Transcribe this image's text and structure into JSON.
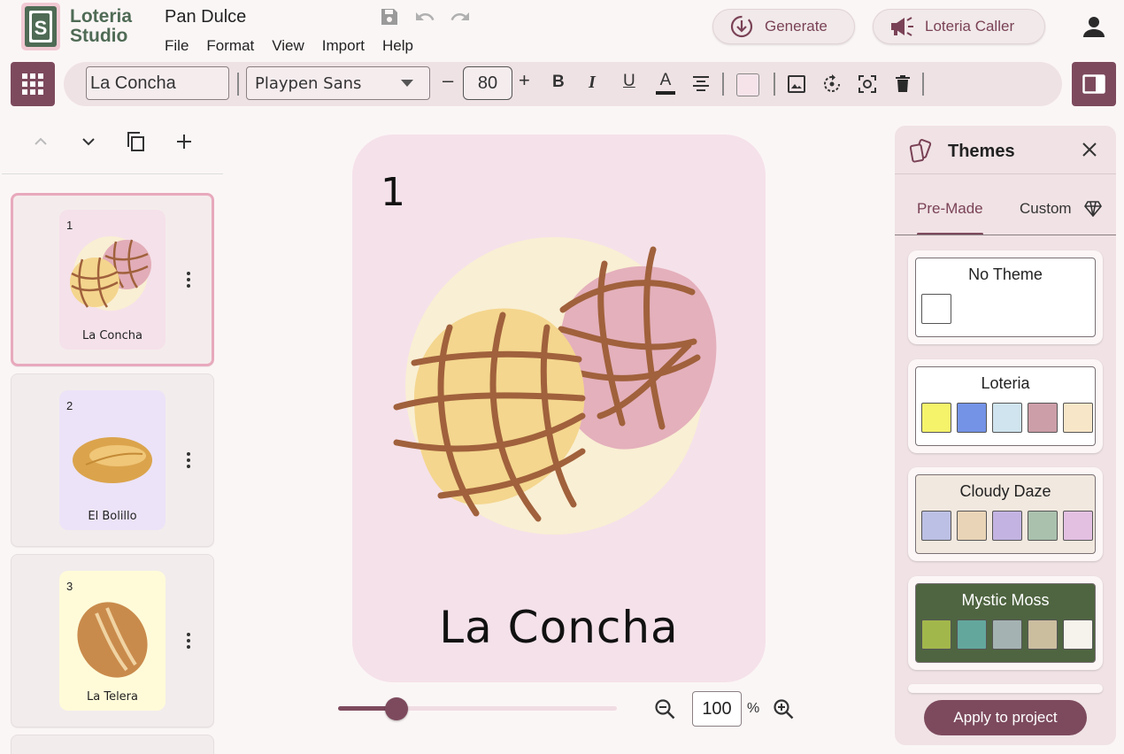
{
  "app": {
    "logo_line1": "Loteria",
    "logo_line2": "Studio",
    "logo_letter": "S",
    "document_title": "Pan Dulce"
  },
  "menu": [
    "File",
    "Format",
    "View",
    "Import",
    "Help"
  ],
  "header_buttons": {
    "generate": "Generate",
    "caller": "Loteria Caller"
  },
  "toolbar": {
    "text_value": "La Concha",
    "font_family": "Playpen Sans",
    "font_size": "80",
    "minus": "–",
    "plus": "+",
    "bold": "B",
    "italic": "I",
    "underline": "U",
    "font_color_label": "A",
    "swatch_color": "#f6e3ea"
  },
  "cards": [
    {
      "number": "1",
      "name": "La Concha",
      "bg": "#f5e1ea"
    },
    {
      "number": "2",
      "name": "El Bolillo",
      "bg": "#ece3f8"
    },
    {
      "number": "3",
      "name": "La Telera",
      "bg": "#fffbd9"
    }
  ],
  "main_card": {
    "number": "1",
    "name": "La Concha"
  },
  "zoom": {
    "value": "100",
    "unit": "%",
    "slider_level": 0.21
  },
  "themes_panel": {
    "title": "Themes",
    "tabs": [
      "Pre-Made",
      "Custom"
    ],
    "apply_label": "Apply to project",
    "themes": [
      {
        "name": "No Theme",
        "bg": "#ffffff",
        "text": "#222222",
        "colors": [
          "#ffffff"
        ]
      },
      {
        "name": "Loteria",
        "bg": "#ffffff",
        "text": "#222222",
        "colors": [
          "#f5f36a",
          "#7493e6",
          "#cfe4ee",
          "#cc9ea8",
          "#f8e6c8"
        ]
      },
      {
        "name": "Cloudy Daze",
        "bg": "#f1e8df",
        "text": "#222222",
        "colors": [
          "#bcc0e4",
          "#e9d4b7",
          "#c3b3e2",
          "#a9c1ad",
          "#e3c0e2"
        ]
      },
      {
        "name": "Mystic Moss",
        "bg": "#4f6541",
        "text": "#ffffff",
        "colors": [
          "#a2b74b",
          "#63a79c",
          "#a4b3b2",
          "#cbbe9f",
          "#f6f2ec"
        ]
      }
    ]
  }
}
